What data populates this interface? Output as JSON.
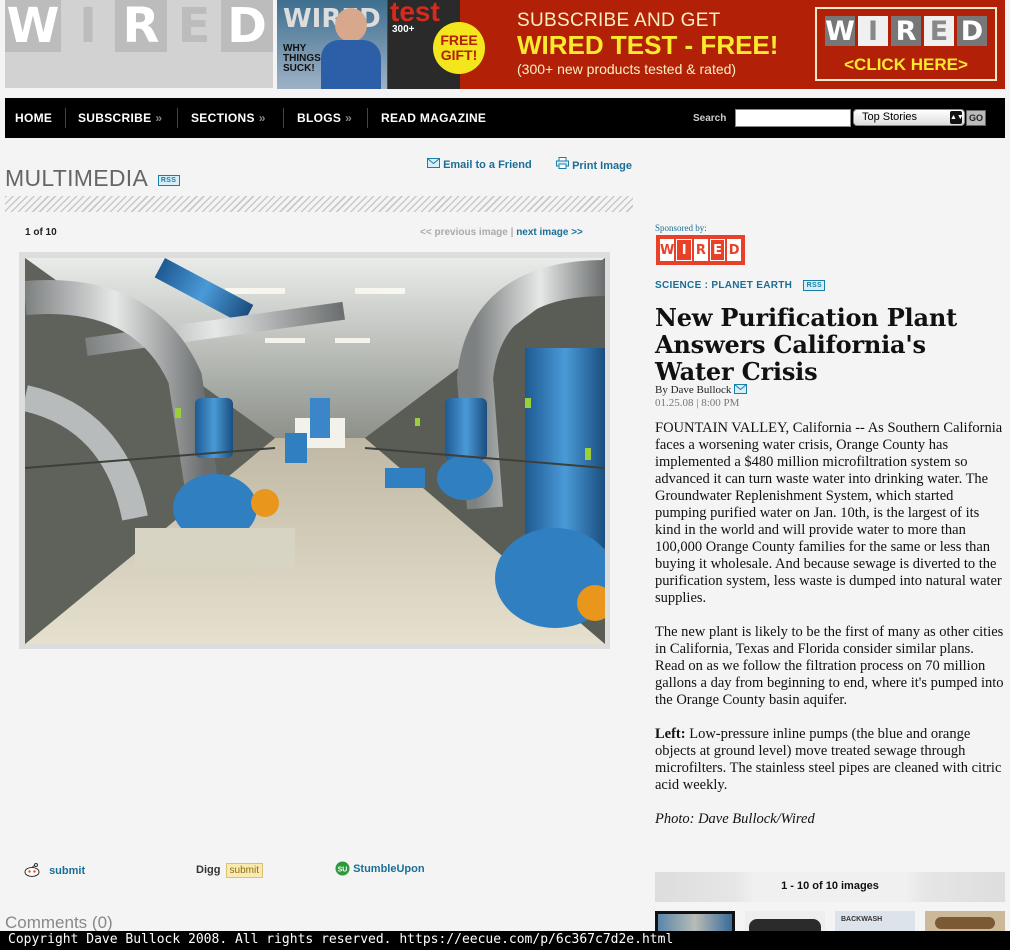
{
  "logo": {
    "letters": [
      "W",
      "I",
      "R",
      "E",
      "D"
    ]
  },
  "ad": {
    "mag1_title": "WIRED",
    "mag1_words": "WHY THINGS SUCK!",
    "mag2_title": "test",
    "mag2_number": "300+",
    "gift": "FREE GIFT!",
    "line1": "SUBSCRIBE AND GET",
    "line2": "WIRED TEST - FREE!",
    "line3": "(300+ new products tested & rated)",
    "button_letters": [
      "W",
      "I",
      "R",
      "E",
      "D"
    ],
    "button_cta": "<CLICK HERE>"
  },
  "nav": {
    "items": [
      "HOME",
      "SUBSCRIBE",
      "SECTIONS",
      "BLOGS",
      "READ MAGAZINE"
    ],
    "chevron": "»",
    "search_label": "Search",
    "search_value": "",
    "select_value": "Top Stories",
    "go_label": "GO"
  },
  "multimedia": {
    "title": "MULTIMEDIA",
    "rss": "RSS",
    "email": "Email to a Friend",
    "print": "Print Image",
    "counter": "1 of 10",
    "prev": "<< previous image",
    "divider": " | ",
    "next": "next image >>"
  },
  "social": {
    "reddit": "submit",
    "digg": "Digg",
    "digg_btn": "submit",
    "stumble": "StumbleUpon"
  },
  "comments": "Comments (0)",
  "article": {
    "sponsored": "Sponsored by:",
    "sponsor_letters": [
      "W",
      "I",
      "R",
      "E",
      "D"
    ],
    "cat1": "SCIENCE",
    "cat_sep": " : ",
    "cat2": "PLANET EARTH",
    "rss": "RSS",
    "headline": "New Purification Plant Answers California's Water Crisis",
    "byline": "By Dave Bullock",
    "date": "01.25.08 | 8:00 PM",
    "p1": "FOUNTAIN VALLEY, California -- As Southern California faces a worsening water crisis, Orange County has implemented a $480 million microfiltration system so advanced it can turn waste water into drinking water. The Groundwater Replenishment System, which started pumping purified water on Jan. 10th, is the largest of its kind in the world and will provide water to more than 100,000 Orange County families for the same or less than buying it wholesale. And because sewage is diverted to the purification system, less waste is dumped into natural water supplies.",
    "p2": "The new plant is likely to be the first of many as other cities in California, Texas and Florida consider similar plans. Read on as we follow the filtration process on 70 million gallons a day from beginning to end, where it's pumped into the Orange County basin aquifer.",
    "p3_lead": "Left:",
    "p3": " Low-pressure inline pumps (the blue and orange objects at ground level) move treated sewage through microfilters. The stainless steel pipes are cleaned with citric acid weekly.",
    "photo_credit": "Photo: Dave Bullock/Wired"
  },
  "gallery": {
    "label": "1 - 10 of 10 images",
    "thumb3_text": "BACKWASH"
  },
  "footer": "Copyright Dave Bullock 2008. All rights reserved. https://eecue.com/p/6c367c7d2e.html",
  "colors": {
    "link": "#1a6e96",
    "ad_bg": "#b22008",
    "ad_yellow": "#fbe92d",
    "nav_bg": "#000000",
    "pipe_blue": "#2f7fc1",
    "pump_orange": "#e8961c"
  }
}
